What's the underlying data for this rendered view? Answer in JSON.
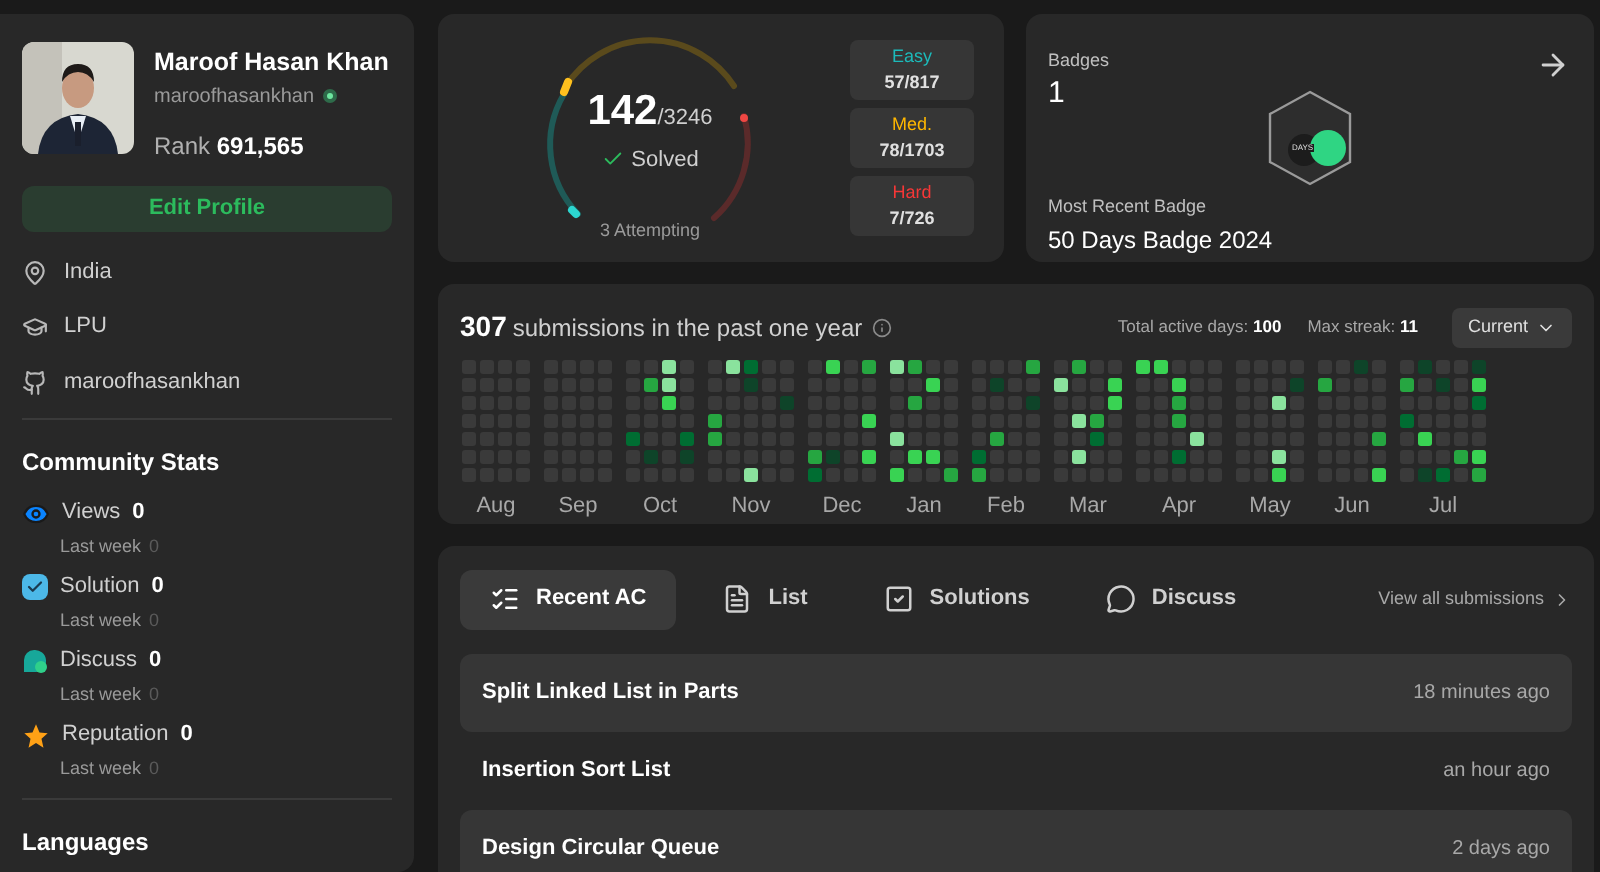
{
  "profile": {
    "name": "Maroof Hasan Khan",
    "username": "maroofhasankhan",
    "rank_label": "Rank",
    "rank": "691,565",
    "edit_button": "Edit Profile",
    "info": [
      {
        "kind": "location",
        "text": "India"
      },
      {
        "kind": "school",
        "text": "LPU"
      },
      {
        "kind": "github",
        "text": "maroofhasankhan"
      }
    ]
  },
  "community_stats": {
    "title": "Community Stats",
    "items": [
      {
        "kind": "views",
        "label": "Views",
        "value": "0",
        "sub_label": "Last week",
        "sub_value": "0"
      },
      {
        "kind": "solution",
        "label": "Solution",
        "value": "0",
        "sub_label": "Last week",
        "sub_value": "0"
      },
      {
        "kind": "discuss",
        "label": "Discuss",
        "value": "0",
        "sub_label": "Last week",
        "sub_value": "0"
      },
      {
        "kind": "reputation",
        "label": "Reputation",
        "value": "0",
        "sub_label": "Last week",
        "sub_value": "0"
      }
    ]
  },
  "languages": {
    "title": "Languages"
  },
  "solved": {
    "count": "142",
    "total": "/3246",
    "label": "Solved",
    "attempting": "3 Attempting",
    "difficulties": [
      {
        "kind": "easy",
        "label": "Easy",
        "value": "57/817"
      },
      {
        "kind": "medium",
        "label": "Med.",
        "value": "78/1703"
      },
      {
        "kind": "hard",
        "label": "Hard",
        "value": "7/726"
      }
    ]
  },
  "badges": {
    "label": "Badges",
    "count": "1",
    "recent_label": "Most Recent Badge",
    "recent_name": "50 Days Badge 2024",
    "badge_text": "DAYS"
  },
  "calendar": {
    "count": "307",
    "title": "submissions in the past one year",
    "active_label": "Total active days:",
    "active_value": "100",
    "streak_label": "Max streak:",
    "streak_value": "11",
    "dropdown": "Current",
    "months": [
      "Aug",
      "Sep",
      "Oct",
      "Nov",
      "Dec",
      "Jan",
      "Feb",
      "Mar",
      "Apr",
      "May",
      "Jun",
      "Jul"
    ]
  },
  "submissions": {
    "tabs": [
      {
        "kind": "recent",
        "label": "Recent AC",
        "selected": true
      },
      {
        "kind": "list",
        "label": "List",
        "selected": false
      },
      {
        "kind": "solutions",
        "label": "Solutions",
        "selected": false
      },
      {
        "kind": "discuss",
        "label": "Discuss",
        "selected": false
      }
    ],
    "view_all": "View all submissions",
    "rows": [
      {
        "title": "Split Linked List in Parts",
        "time": "18 minutes ago"
      },
      {
        "title": "Insertion Sort List",
        "time": "an hour ago"
      },
      {
        "title": "Design Circular Queue",
        "time": "2 days ago"
      }
    ]
  }
}
